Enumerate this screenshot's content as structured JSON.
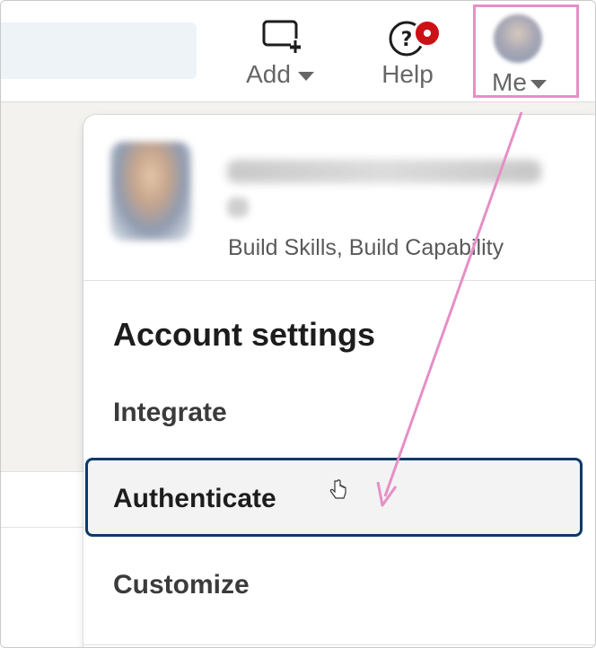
{
  "topnav": {
    "add": {
      "label": "Add",
      "icon": "add-post-icon"
    },
    "help": {
      "label": "Help",
      "icon": "help-icon",
      "notification": "help-notification-badge"
    },
    "me": {
      "label": "Me",
      "icon": "avatar"
    }
  },
  "dropdown": {
    "profile": {
      "tagline": "Build Skills, Build Capability"
    },
    "section_title": "Account settings",
    "items": [
      {
        "label": "Integrate"
      },
      {
        "label": "Authenticate"
      },
      {
        "label": "Customize"
      }
    ]
  },
  "colors": {
    "highlight_border": "#e68fc6",
    "annotation_arrow": "#e68fc6",
    "focus_border": "#0a3a6b",
    "notification_red": "#cc1016"
  }
}
